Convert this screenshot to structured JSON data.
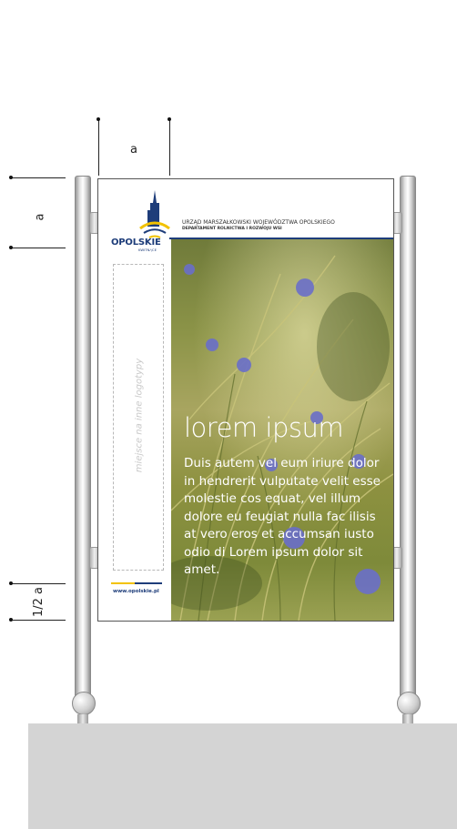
{
  "dimensions": {
    "top_label": "a",
    "side_label": "a",
    "bottom_label": "1/2 a"
  },
  "panel": {
    "brand": "OPOLSKIE",
    "brand_tagline": "KWITNĄCE",
    "office_line1": "URZĄD MARSZAŁKOWSKI WOJEWÓDZTWA OPOLSKIEGO",
    "office_line2": "DEPARTAMENT ROLNICTWA I ROZWOJU WSI",
    "logo_placeholder": "miejsce na inne logotypy",
    "website": "www.opolskie.pl",
    "headline": "lorem ipsum",
    "body": "Duis autem vel eum iriure dolor in hendrerit vulputate velit esse molestie cos equat, vel illum dolore eu feugiat nulla fac ilisis at vero eros et accumsan iusto odio di Lorem ipsum dolor sit amet."
  },
  "colors": {
    "brand_blue": "#1e3d7a",
    "brand_yellow": "#f2c200",
    "ground": "#d4d4d4"
  }
}
